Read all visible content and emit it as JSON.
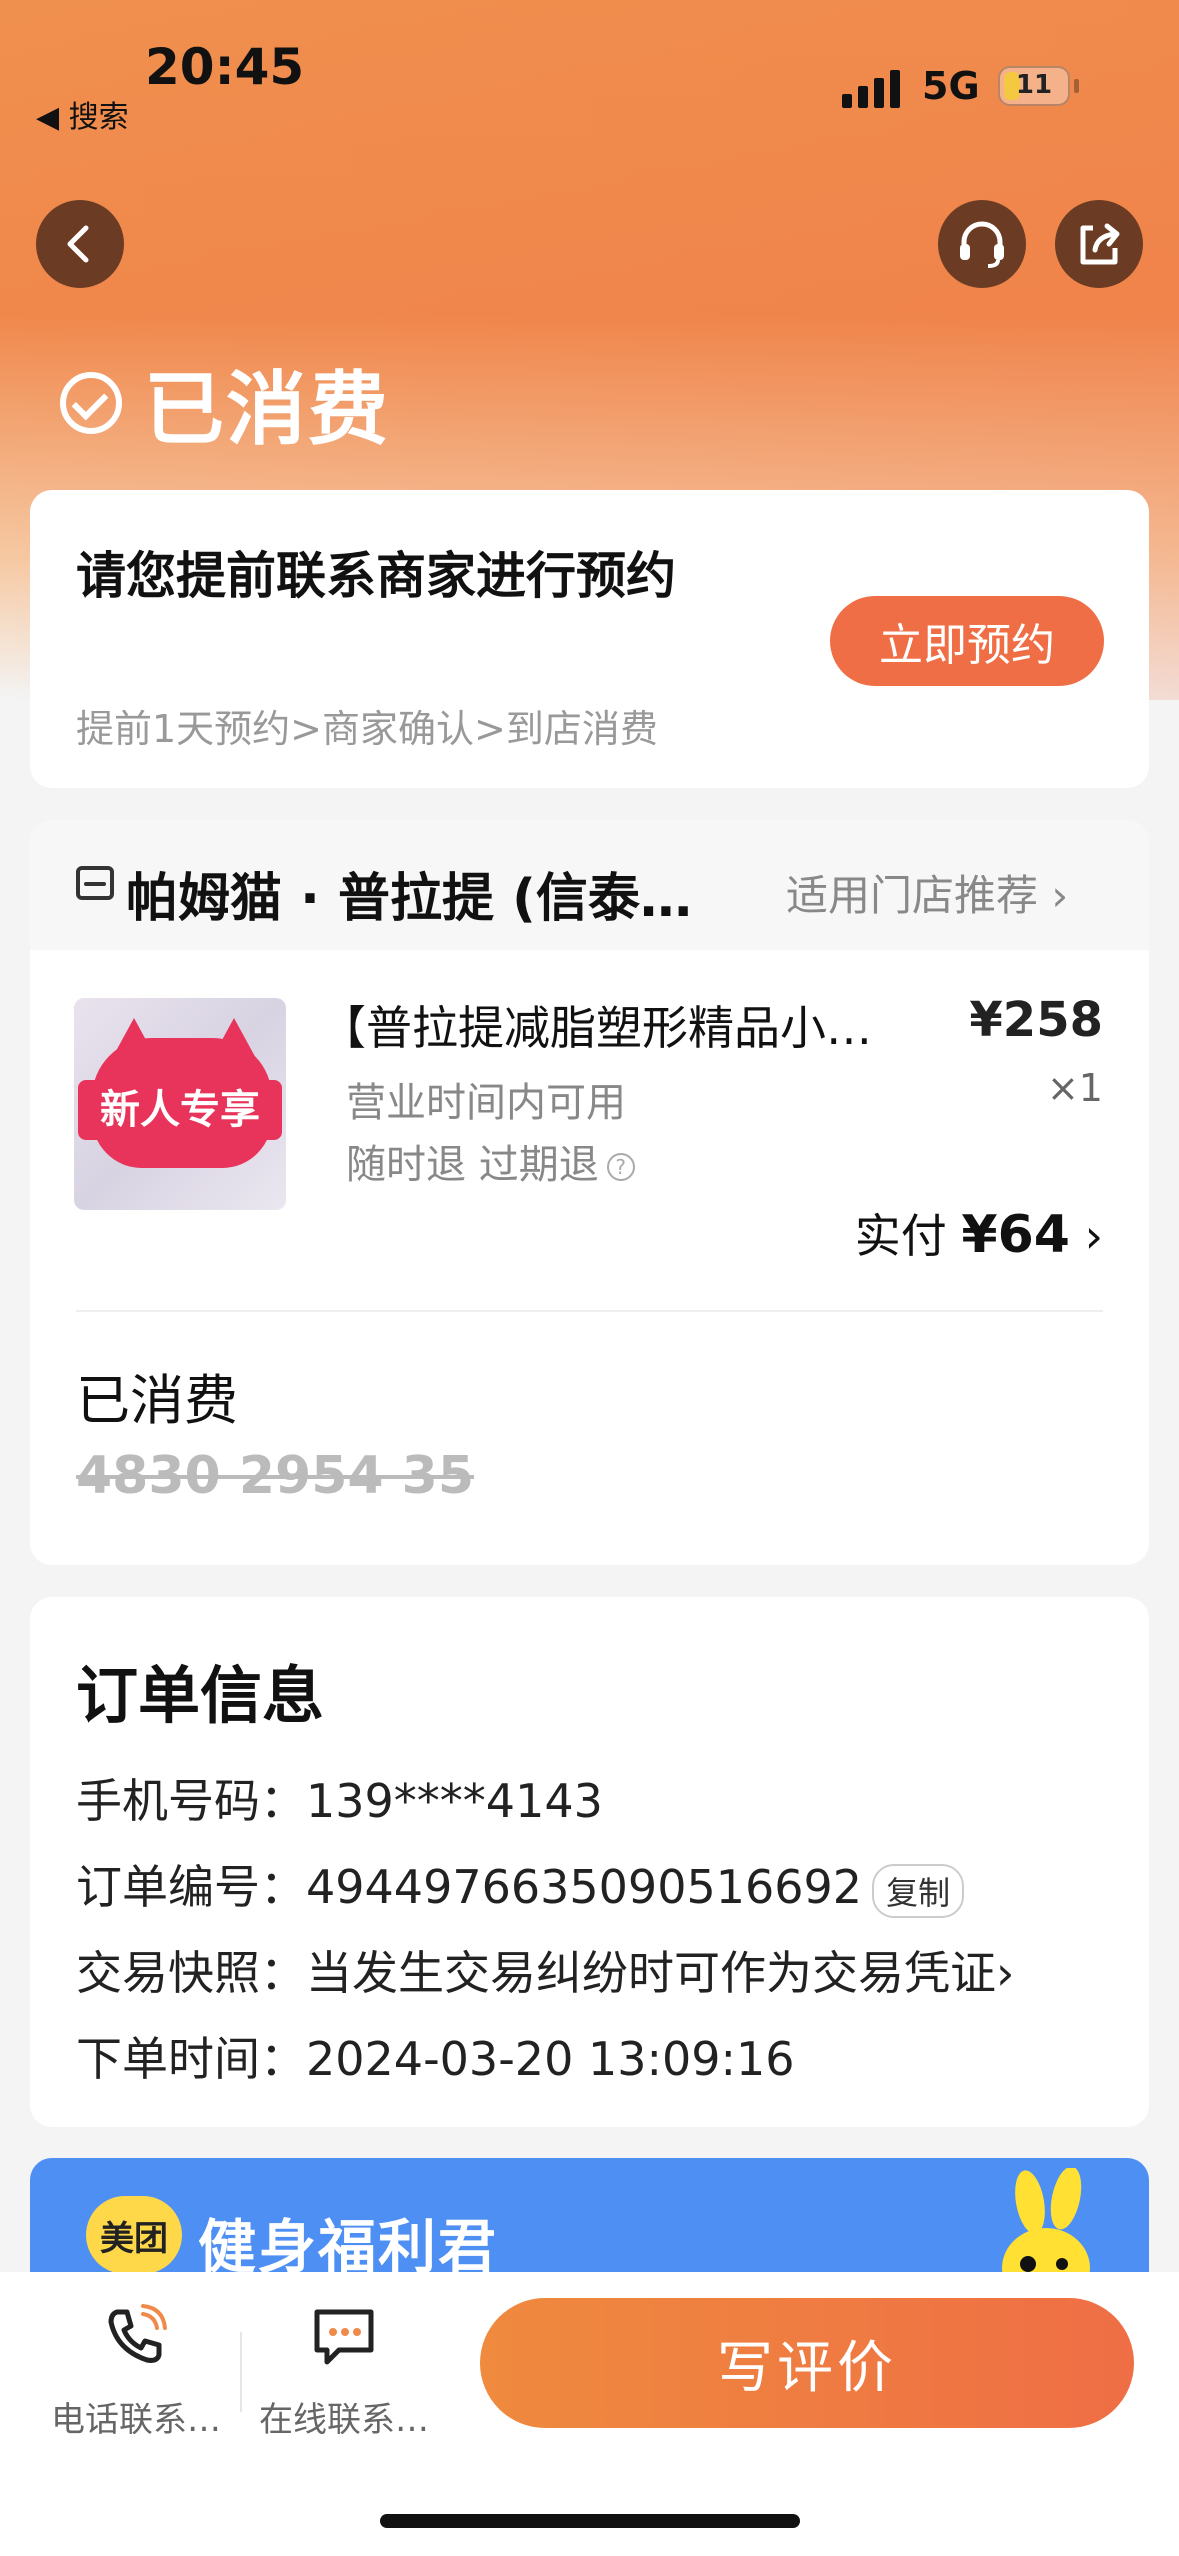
{
  "status_bar": {
    "time": "20:45",
    "back_app": "◀ 搜索",
    "network": "5G",
    "battery": "11"
  },
  "header": {
    "title": "已消费"
  },
  "booking_card": {
    "title": "请您提前联系商家进行预约",
    "steps": "提前1天预约>商家确认>到店消费",
    "button": "立即预约"
  },
  "order_card": {
    "store_name": "帕姆猫 · 普拉提 (信泰…",
    "store_link": "适用门店推荐",
    "thumb_badge": "新人专享",
    "product_title": "【普拉提减脂塑形精品小…",
    "price": "¥258",
    "quantity": "×1",
    "usage_time": "营业时间内可用",
    "refund_policy": "随时退 过期退",
    "paid_label": "实付",
    "paid_amount": "¥64",
    "status": "已消费",
    "voucher_code": "4830 2954 35"
  },
  "order_info": {
    "title": "订单信息",
    "phone_label": "手机号码：",
    "phone_value": "139****4143",
    "order_no_label": "订单编号：",
    "order_no_value": "4944976635090516692",
    "copy": "复制",
    "snapshot_label": "交易快照：",
    "snapshot_value": "当发生交易纠纷时可作为交易凭证",
    "time_label": "下单时间：",
    "time_value": "2024-03-20 13:09:16"
  },
  "banner": {
    "logo": "美团",
    "text": "健身福利君"
  },
  "bottom_bar": {
    "phone": "电话联系…",
    "chat": "在线联系…",
    "review": "写评价"
  },
  "colors": {
    "accent": "#ef6e45",
    "header_gradient_start": "#f0904e",
    "banner_blue": "#4e8ff3",
    "badge_red": "#e8335b"
  }
}
